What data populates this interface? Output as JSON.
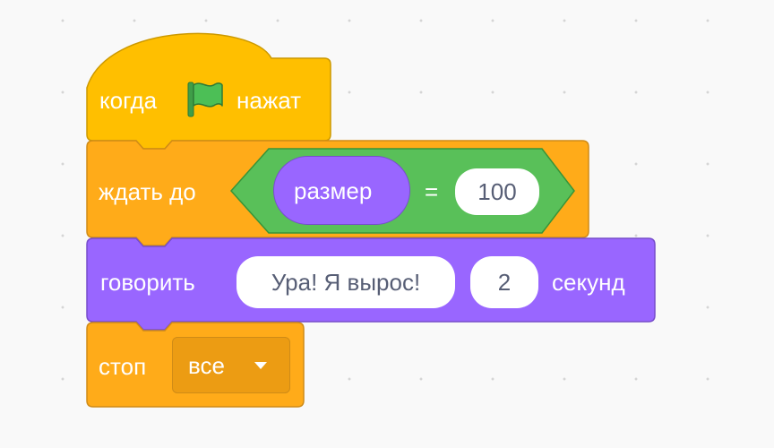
{
  "colors": {
    "events": "#ffbf00",
    "events_border": "#cc9900",
    "control": "#ffab19",
    "control_border": "#cf8b17",
    "looks": "#9966ff",
    "looks_border": "#774dcb",
    "operators": "#59c059",
    "operators_border": "#389438",
    "slot_text": "#575e75",
    "flag": "#4cbf56"
  },
  "script": {
    "hat": {
      "before": "когда",
      "icon": "green-flag-icon",
      "after": "нажат"
    },
    "wait_until": {
      "label": "ждать до",
      "condition": {
        "reporter": "размер",
        "operator": "=",
        "value": "100"
      }
    },
    "say_for": {
      "label": "говорить",
      "message": "Ура! Я вырос!",
      "seconds": "2",
      "unit": "секунд"
    },
    "stop": {
      "label": "стоп",
      "option": "все"
    }
  }
}
